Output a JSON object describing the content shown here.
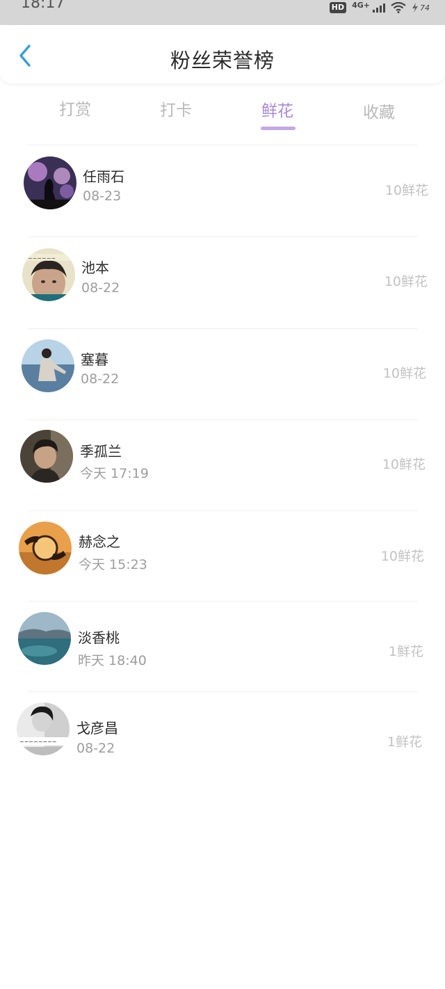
{
  "status_bar": {
    "time": "18:17",
    "hd": "HD",
    "network": "4G+",
    "battery": "74"
  },
  "header": {
    "title": "粉丝荣誉榜"
  },
  "tabs": [
    {
      "label": "打赏",
      "active": false
    },
    {
      "label": "打卡",
      "active": false
    },
    {
      "label": "鲜花",
      "active": true
    },
    {
      "label": "收藏",
      "active": false
    }
  ],
  "colors": {
    "accent": "#a888d8",
    "back_arrow": "#3a9bdc"
  },
  "fans": [
    {
      "name": "任雨石",
      "date": "08-23",
      "amount": "10鲜花",
      "avatar_icon": "avatar-purple-sky"
    },
    {
      "name": "池本",
      "date": "08-22",
      "amount": "10鲜花",
      "avatar_icon": "avatar-boy-portrait"
    },
    {
      "name": "塞暮",
      "date": "08-22",
      "amount": "10鲜花",
      "avatar_icon": "avatar-girl-sea"
    },
    {
      "name": "季孤兰",
      "date": "今天 17:19",
      "amount": "10鲜花",
      "avatar_icon": "avatar-dark-portrait"
    },
    {
      "name": "赫念之",
      "date": "今天 15:23",
      "amount": "10鲜花",
      "avatar_icon": "avatar-sunset-ball"
    },
    {
      "name": "淡香桃",
      "date": "昨天 18:40",
      "amount": "1鲜花",
      "avatar_icon": "avatar-ocean"
    },
    {
      "name": "戈彦昌",
      "date": "08-22",
      "amount": "1鲜花",
      "avatar_icon": "avatar-bw-girl"
    }
  ]
}
